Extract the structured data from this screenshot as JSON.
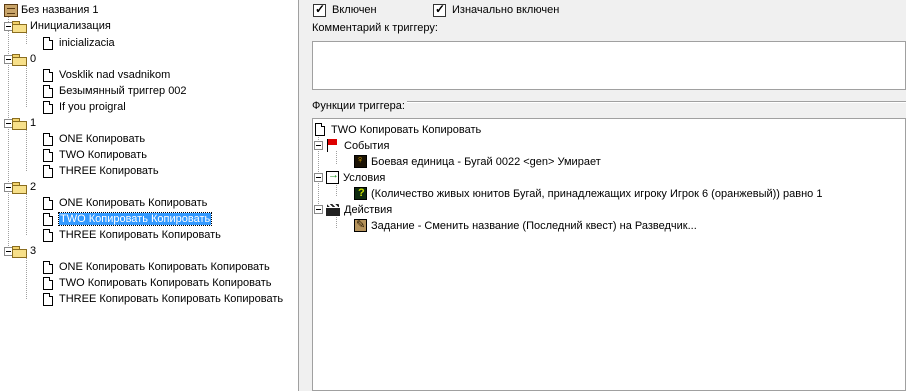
{
  "tree": {
    "root_label": "Без названия 1",
    "categories": [
      {
        "label": "Инициализация",
        "triggers": [
          "inicializacia"
        ]
      },
      {
        "label": "0",
        "triggers": [
          "Vosklik nad vsadnikom",
          "Безымянный триггер 002",
          "If you proigral"
        ]
      },
      {
        "label": "1",
        "triggers": [
          "ONE Копировать",
          "TWO Копировать",
          "THREE Копировать"
        ]
      },
      {
        "label": "2",
        "triggers": [
          "ONE Копировать Копировать",
          "TWO Копировать Копировать",
          "THREE Копировать Копировать"
        ]
      },
      {
        "label": "3",
        "triggers": [
          "ONE Копировать Копировать Копировать",
          "TWO Копировать Копировать Копировать",
          "THREE Копировать Копировать Копировать"
        ]
      }
    ],
    "selected_trigger": "TWO Копировать Копировать"
  },
  "options": {
    "enabled_label": "Включен",
    "enabled_checked": true,
    "initially_enabled_label": "Изначально включен",
    "initially_enabled_checked": true
  },
  "comment": {
    "label": "Комментарий к триггеру:",
    "value": ""
  },
  "functions": {
    "label": "Функции триггера:",
    "trigger_name": "TWO Копировать Копировать",
    "events_label": "События",
    "event_item": "Боевая единица - Бугай 0022 <gen> Умирает",
    "conditions_label": "Условия",
    "condition_item": "(Количество живых юнитов Бугай, принадлежащих игроку Игрок 6 (оранжевый)) равно 1",
    "actions_label": "Действия",
    "action_item": "Задание - Сменить название (Последний квест) на Разведчик..."
  }
}
